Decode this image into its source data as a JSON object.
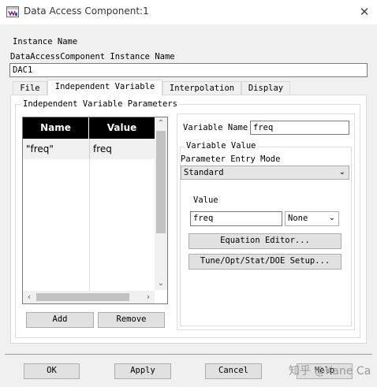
{
  "window": {
    "title": "Data Access Component:1",
    "close_label": "✕"
  },
  "instance": {
    "section_label": "Instance Name",
    "field_label": "DataAccessComponent Instance Name",
    "value": "DAC1"
  },
  "tabs": [
    {
      "label": "File",
      "active": false
    },
    {
      "label": "Independent Variable",
      "active": true
    },
    {
      "label": "Interpolation",
      "active": false
    },
    {
      "label": "Display",
      "active": false
    }
  ],
  "params": {
    "group_title": "Independent Variable Parameters",
    "table": {
      "headers": [
        "Name",
        "Value"
      ],
      "rows": [
        {
          "name": "\"freq\"",
          "value": "freq"
        }
      ]
    },
    "add_label": "Add",
    "remove_label": "Remove"
  },
  "variable": {
    "name_label": "Variable Name",
    "name_value": "freq",
    "value_group_title": "Variable Value",
    "entry_mode_label": "Parameter Entry Mode",
    "entry_mode_value": "Standard",
    "value_label": "Value",
    "value_value": "freq",
    "unit_value": "None",
    "equation_editor_label": "Equation Editor...",
    "tune_setup_label": "Tune/Opt/Stat/DOE Setup..."
  },
  "footer": {
    "ok_label": "OK",
    "apply_label": "Apply",
    "cancel_label": "Cancel",
    "help_label": "Help"
  },
  "watermark": "知乎 @Kane Ca"
}
